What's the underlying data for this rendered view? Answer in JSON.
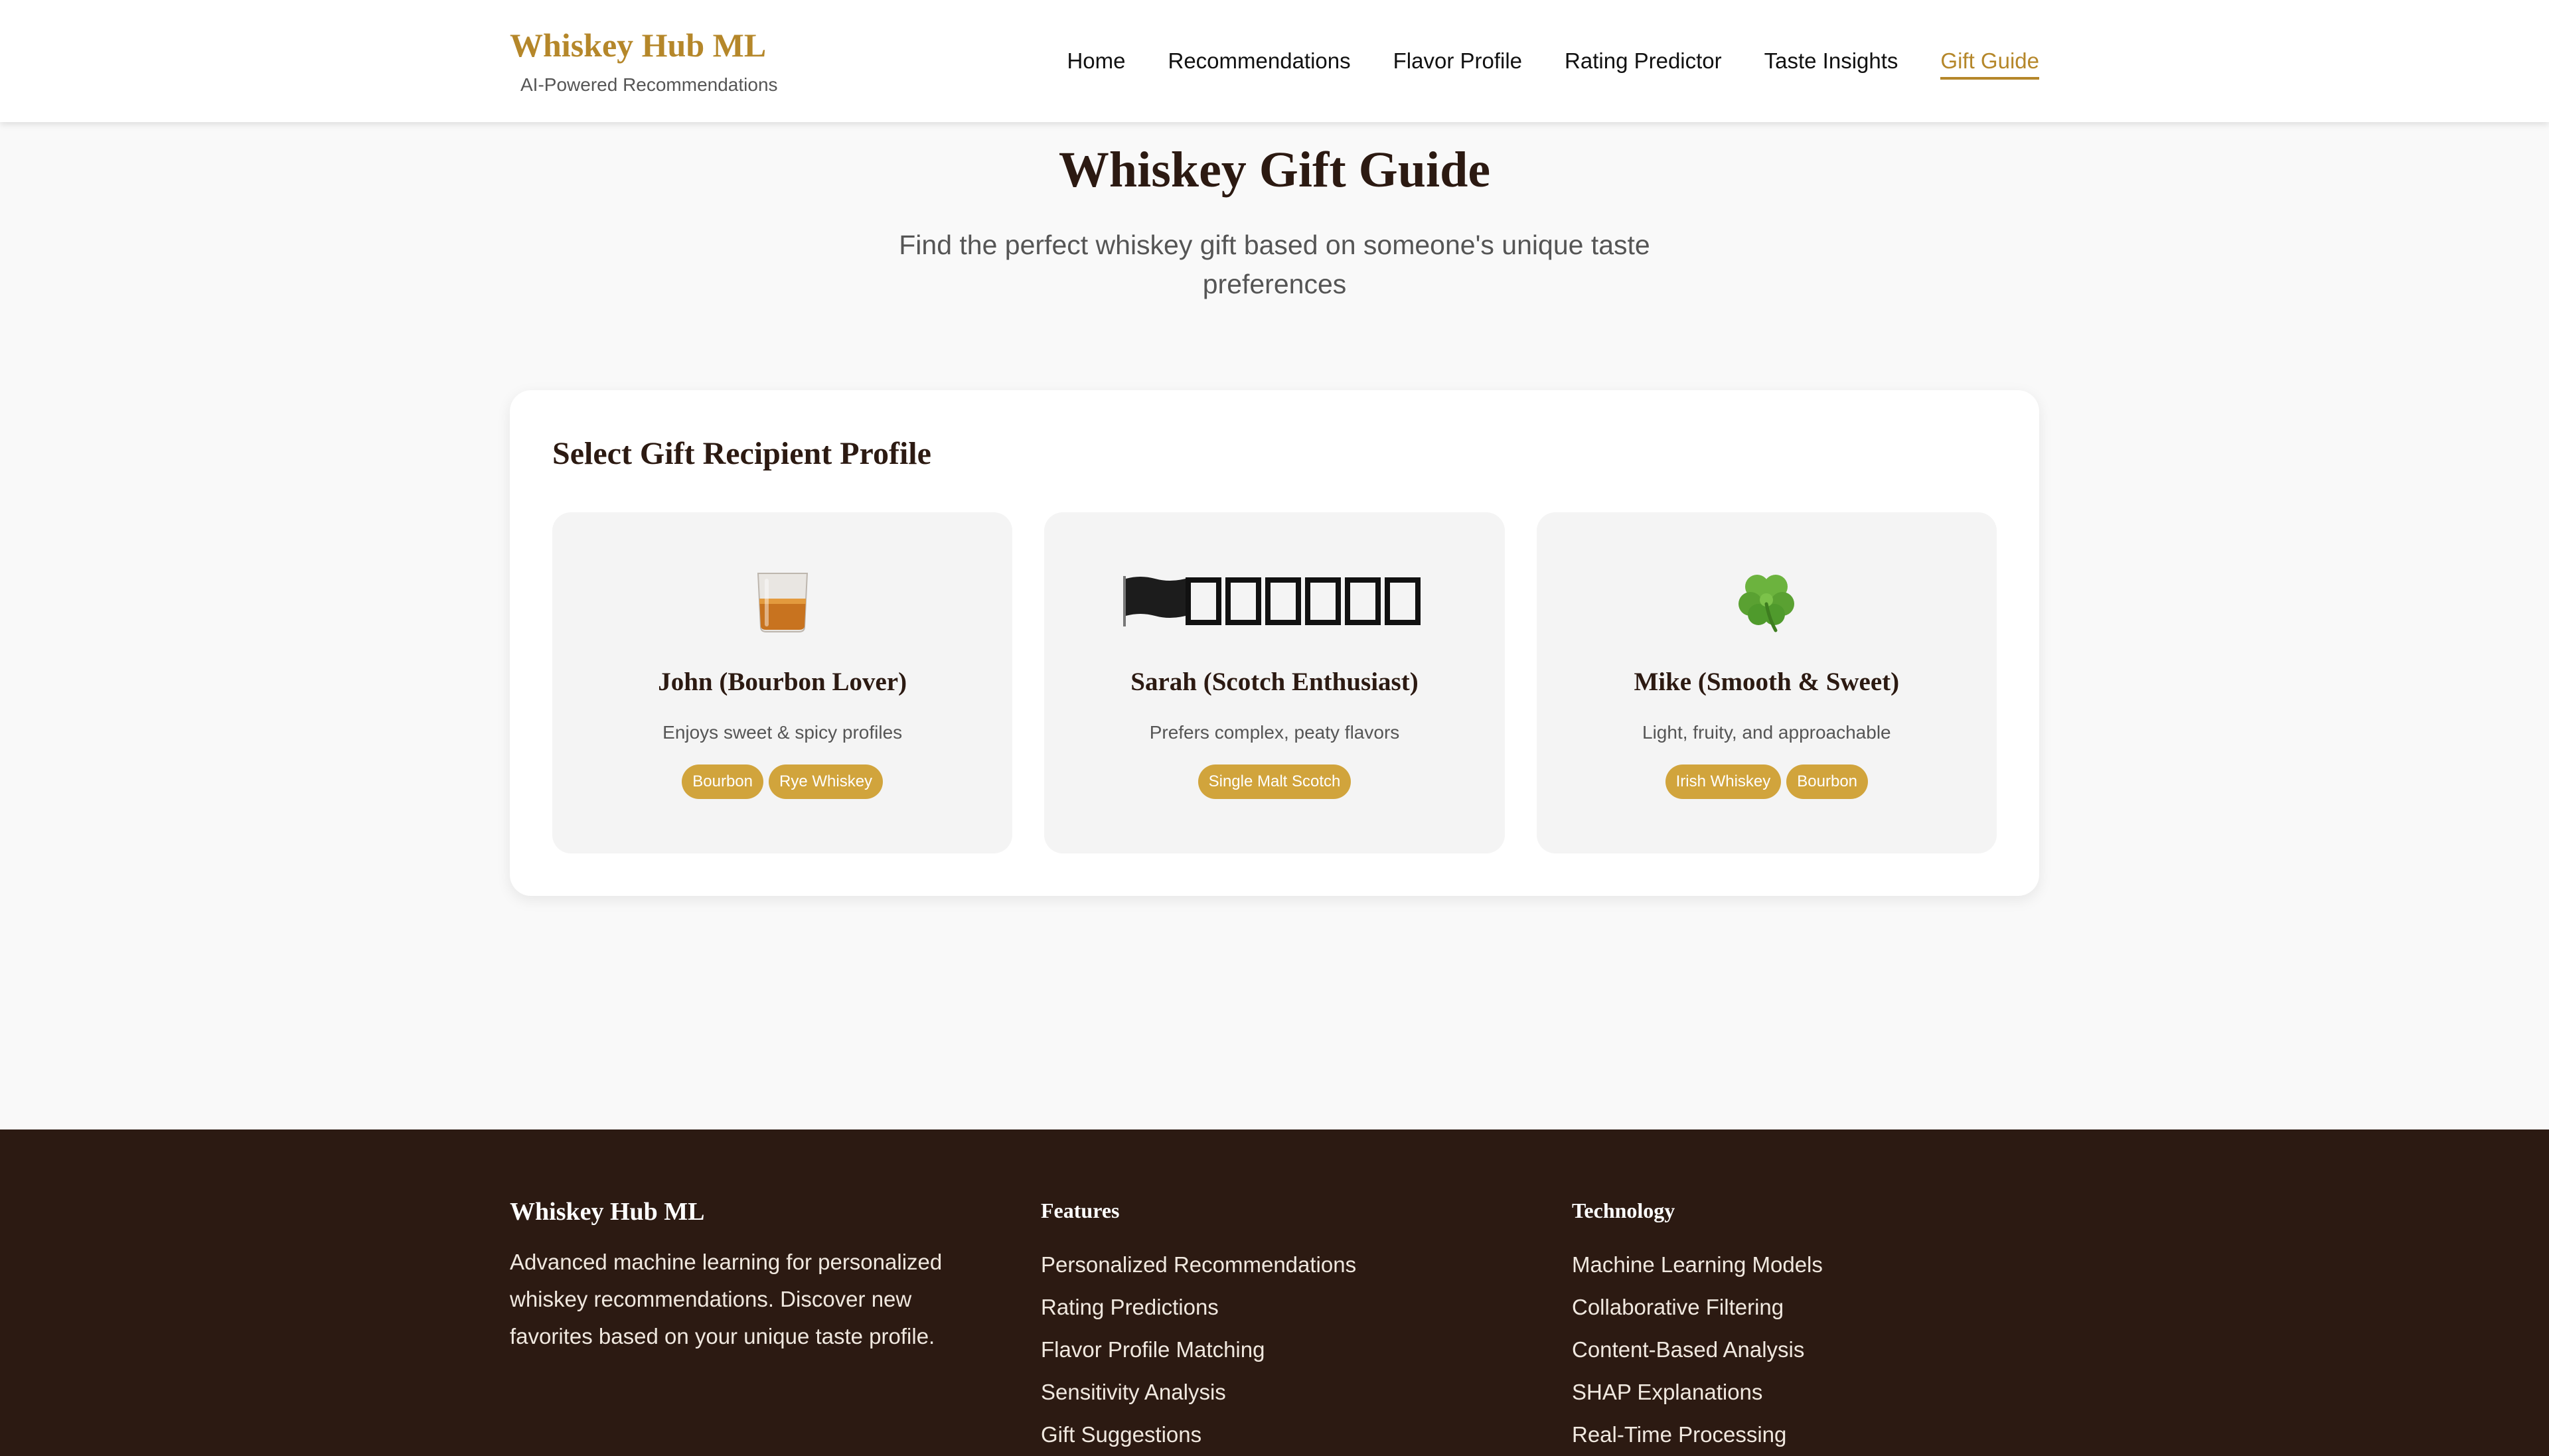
{
  "header": {
    "brand_title": "Whiskey Hub ML",
    "brand_subtitle": "AI-Powered Recommendations",
    "nav": [
      {
        "label": "Home"
      },
      {
        "label": "Recommendations"
      },
      {
        "label": "Flavor Profile"
      },
      {
        "label": "Rating Predictor"
      },
      {
        "label": "Taste Insights"
      },
      {
        "label": "Gift Guide",
        "active": true
      }
    ]
  },
  "hero": {
    "title": "Whiskey Gift Guide",
    "subtitle": "Find the perfect whiskey gift based on someone's unique taste preferences"
  },
  "panel": {
    "title": "Select Gift Recipient Profile",
    "cards": [
      {
        "icon": "whiskey-glass-icon",
        "name": "John (Bourbon Lover)",
        "description": "Enjoys sweet & spicy profiles",
        "tags": [
          "Bourbon",
          "Rye Whiskey"
        ]
      },
      {
        "icon": "scotland-flag-icon",
        "name": "Sarah (Scotch Enthusiast)",
        "description": "Prefers complex, peaty flavors",
        "tags": [
          "Single Malt Scotch"
        ]
      },
      {
        "icon": "shamrock-icon",
        "name": "Mike (Smooth & Sweet)",
        "description": "Light, fruity, and approachable",
        "tags": [
          "Irish Whiskey",
          "Bourbon"
        ]
      }
    ]
  },
  "footer": {
    "brand": "Whiskey Hub ML",
    "description": "Advanced machine learning for personalized whiskey recommendations. Discover new favorites based on your unique taste profile.",
    "features_heading": "Features",
    "features": [
      "Personalized Recommendations",
      "Rating Predictions",
      "Flavor Profile Matching",
      "Sensitivity Analysis",
      "Gift Suggestions"
    ],
    "technology_heading": "Technology",
    "technology": [
      "Machine Learning Models",
      "Collaborative Filtering",
      "Content-Based Analysis",
      "SHAP Explanations",
      "Real-Time Processing"
    ]
  },
  "colors": {
    "accent": "#b5872a",
    "tag": "#d1a43c",
    "footer_bg": "#2c1a12",
    "page_bg": "#f9f9f9"
  }
}
